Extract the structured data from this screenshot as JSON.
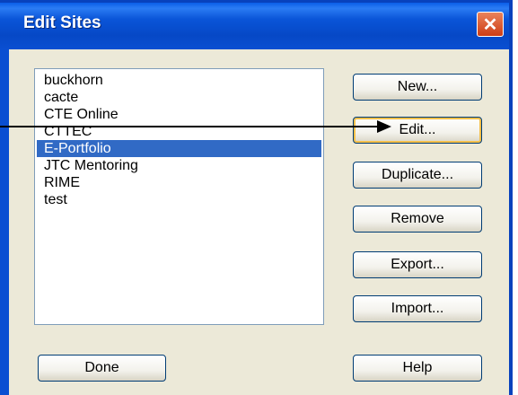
{
  "window": {
    "title": "Edit Sites"
  },
  "sites": [
    {
      "label": "buckhorn",
      "selected": false
    },
    {
      "label": "cacte",
      "selected": false
    },
    {
      "label": "CTE Online",
      "selected": false
    },
    {
      "label": "CTTEC",
      "selected": false
    },
    {
      "label": "E-Portfolio",
      "selected": true
    },
    {
      "label": "JTC Mentoring",
      "selected": false
    },
    {
      "label": "RIME",
      "selected": false
    },
    {
      "label": "test",
      "selected": false
    }
  ],
  "buttons": {
    "new": "New...",
    "edit": "Edit...",
    "duplicate": "Duplicate...",
    "remove": "Remove",
    "export": "Export...",
    "import": "Import...",
    "done": "Done",
    "help": "Help"
  },
  "colors": {
    "titlebar": "#0a55d8",
    "selection": "#316ac5",
    "close": "#cf3d15"
  },
  "icons": {
    "close": "close-icon",
    "callout": "arrow-right-icon"
  }
}
